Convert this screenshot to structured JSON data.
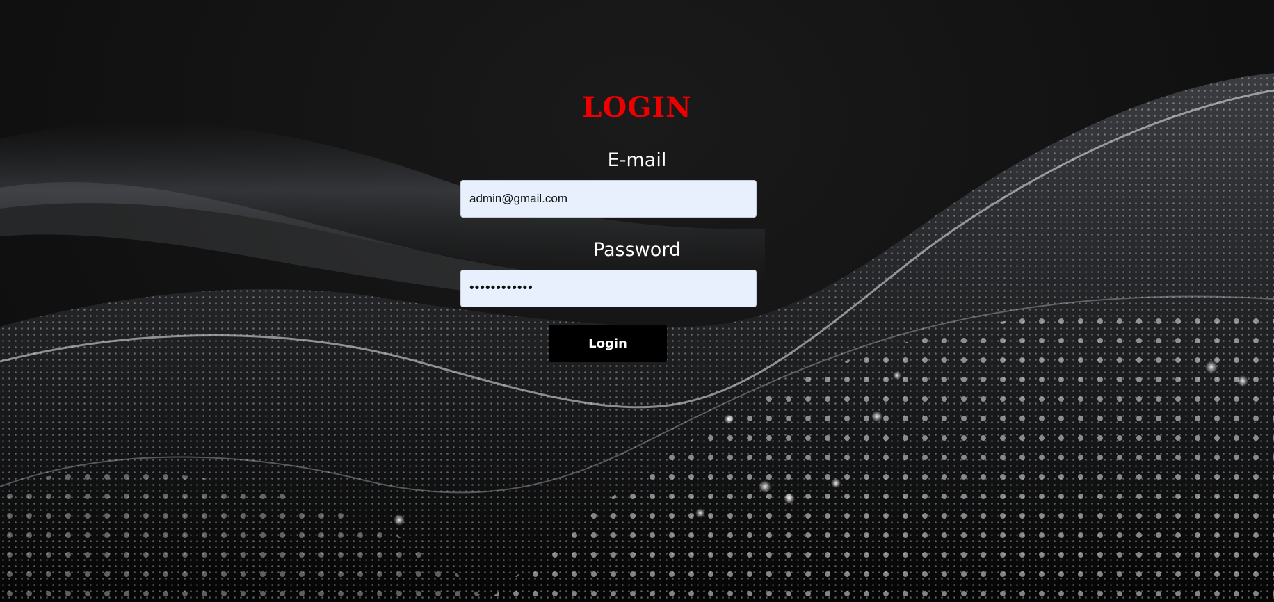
{
  "page": {
    "title": "LOGIN",
    "title_color": "#ee0000",
    "background_color": "#111111"
  },
  "form": {
    "email_label": "E-mail",
    "email_value": "admin@gmail.com",
    "password_label": "Password",
    "password_value": "••••••••••••",
    "submit_label": "Login",
    "field_background": "#e8f0fe",
    "button_background": "#000000"
  }
}
